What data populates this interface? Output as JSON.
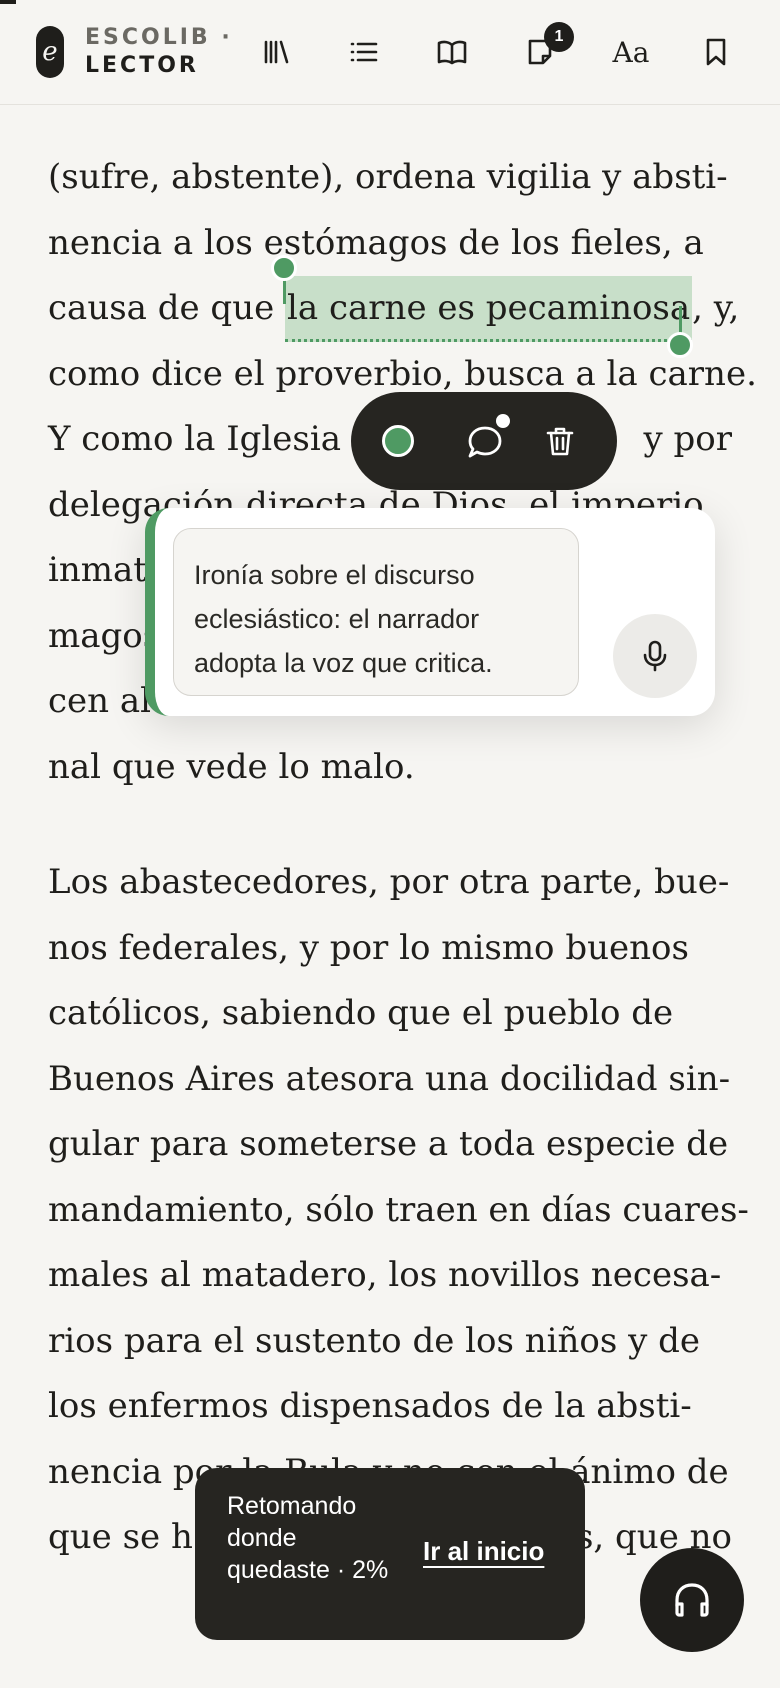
{
  "header": {
    "logo_glyph": "e",
    "brand_line1": "ESCOLIB ·",
    "brand_line2": "LECTOR",
    "notes_badge": "1",
    "font_button": "Aa",
    "icons": [
      "library-icon",
      "toc-list-icon",
      "open-book-icon",
      "notes-icon",
      "font-size-button",
      "bookmark-icon"
    ]
  },
  "reading": {
    "para1": [
      "(sufre, abstente), ordena vigilia y absti-",
      "nencia a los estómagos de los fieles, a",
      "causa de que",
      "la carne es pecaminosa",
      ", y,",
      "como dice el proverbio, busca a la carne.",
      "Y como la Iglesia",
      "y por",
      "delegación directa de Dios, el imperio",
      "inmat",
      "magos",
      "cen al",
      "nal que vede lo malo."
    ],
    "para2": [
      "Los abastecedores, por otra parte, bue-",
      "nos federales, y por lo mismo buenos",
      "católicos, sabiendo que el pueblo de",
      "Buenos Aires atesora una docilidad sin-",
      "gular para someterse a toda especie de",
      "mandamiento, sólo traen en días cuares-",
      "males al matadero, los novillos necesa-",
      "rios para el sustento de los niños y de",
      "los enfermos dispensados de la absti-",
      "nencia por la Bula y no con el ánimo de",
      "que se h",
      "s, que no"
    ]
  },
  "highlight": {
    "text": "la carne es pecaminosa",
    "color": "#c8dfc9",
    "accent": "#4f9a63"
  },
  "annotation_toolbar": {
    "color_dot": "#4f9a63",
    "icons": [
      "highlight-color-dot",
      "comment-icon",
      "trash-icon"
    ]
  },
  "note": {
    "text": "Ironía sobre el discurso eclesiástico: el narrador adopta la voz que critica.",
    "mic_icon": "microphone-icon"
  },
  "toast": {
    "message": "Retomando donde quedaste · 2%",
    "action": "Ir al inicio"
  },
  "fab": {
    "icon": "headphones-icon"
  }
}
